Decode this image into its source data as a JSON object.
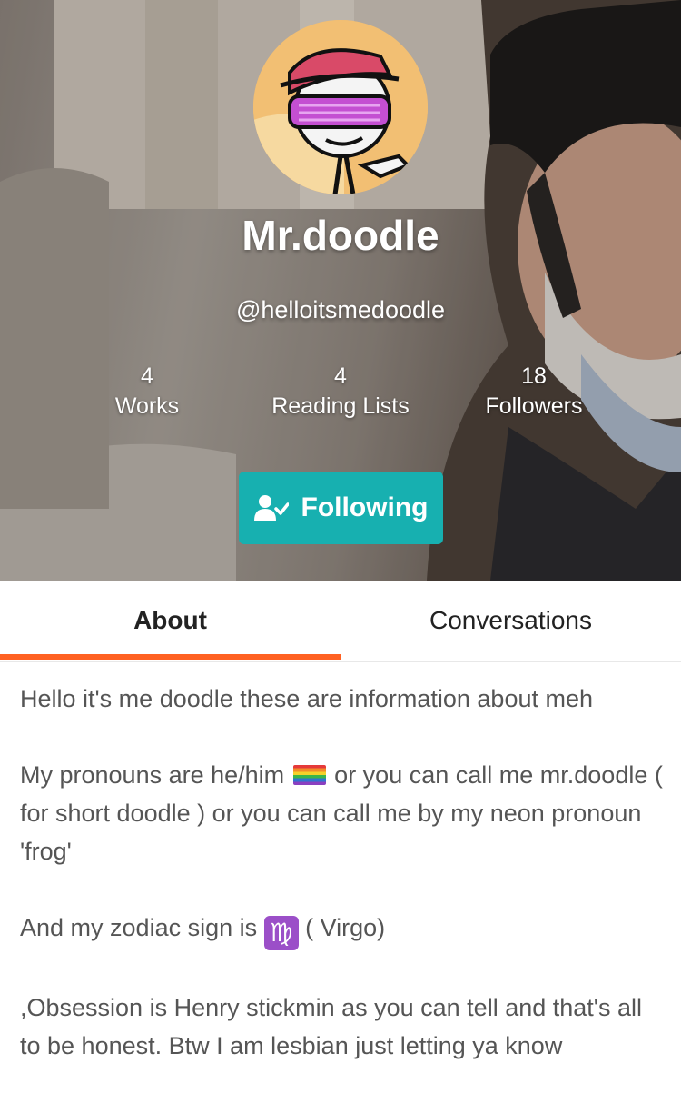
{
  "profile": {
    "display_name": "Mr.doodle",
    "username": "@helloitsmedoodle"
  },
  "stats": [
    {
      "count": "4",
      "label": "Works"
    },
    {
      "count": "4",
      "label": "Reading Lists"
    },
    {
      "count": "18",
      "label": "Followers"
    }
  ],
  "follow_button": {
    "label": "Following",
    "icon": "user-check-icon"
  },
  "tabs": [
    {
      "label": "About",
      "active": true
    },
    {
      "label": "Conversations",
      "active": false
    }
  ],
  "about": {
    "line1": "Hello it's me doodle these are information about meh",
    "pronouns_a": "My pronouns are he/him",
    "pronouns_b": " or you can call me mr.doodle ( for short doodle ) or you can call me by my neon pronoun 'frog'",
    "zodiac_a": "And my zodiac sign is ",
    "zodiac_symbol": "♍",
    "zodiac_b": " ( Virgo)",
    "obsession": ",Obsession is Henry stickmin as you can tell and that's all to be honest. Btw I am lesbian just letting ya know"
  },
  "colors": {
    "accent_teal": "#17b0b0",
    "tab_indicator": "#ff6122"
  }
}
